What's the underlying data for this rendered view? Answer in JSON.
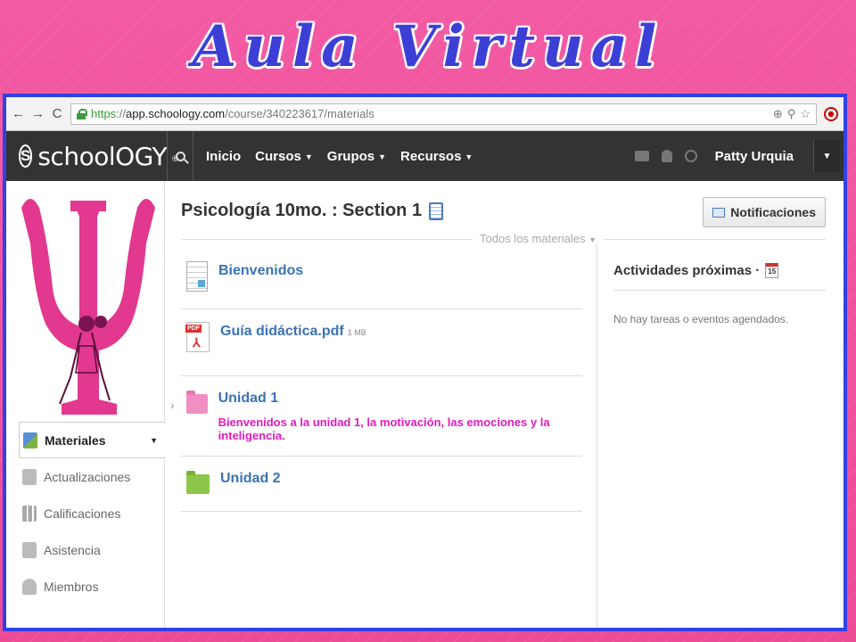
{
  "slide": {
    "title": "Aula Virtual"
  },
  "browser": {
    "url_https": "https",
    "url_sep": "://",
    "url_host": "app.schoology.com",
    "url_path": "/course/340223617/materials",
    "back_icon": "back-arrow-icon",
    "forward_icon": "forward-arrow-icon",
    "reload_icon": "reload-icon"
  },
  "header": {
    "logo_letter": "S",
    "logo_text": "schoolOGY",
    "logo_tm": "®",
    "nav": [
      {
        "label": "Inicio"
      },
      {
        "label": "Cursos"
      },
      {
        "label": "Grupos"
      },
      {
        "label": "Recursos"
      }
    ],
    "user_name": "Patty Urquia"
  },
  "sidebar": {
    "items": [
      {
        "label": "Materiales"
      },
      {
        "label": "Actualizaciones"
      },
      {
        "label": "Calificaciones"
      },
      {
        "label": "Asistencia"
      },
      {
        "label": "Miembros"
      }
    ]
  },
  "main": {
    "course_title": "Psicología 10mo. : Section 1",
    "notifications_label": "Notificaciones",
    "filter_label": "Todos los materiales",
    "materials": [
      {
        "title": "Bienvenidos"
      },
      {
        "title": "Guía didáctica.pdf",
        "size": "1 MB"
      },
      {
        "title": "Unidad 1",
        "description": "Bienvenidos a la unidad 1, la motivación, las emociones y la inteligencia."
      },
      {
        "title": "Unidad 2"
      }
    ]
  },
  "upcoming": {
    "title": "Actividades próximas ·",
    "calendar_day": "15",
    "empty_text": "No hay tareas o eventos agendados."
  },
  "colors": {
    "background": "#f0509c",
    "frame": "#2f41e6",
    "title": "#3c3fd6",
    "link": "#3a73b5",
    "description": "#e21bbd",
    "header": "#333333"
  }
}
